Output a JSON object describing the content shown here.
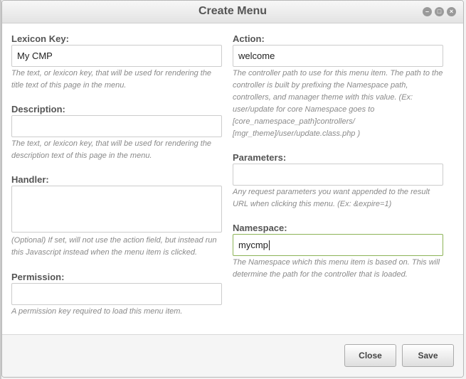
{
  "window": {
    "title": "Create Menu",
    "controls": [
      "minimize-icon",
      "maximize-icon",
      "close-icon"
    ]
  },
  "form": {
    "lexicon_key": {
      "label": "Lexicon Key:",
      "value": "My CMP",
      "hint": "The text, or lexicon key, that will be used for rendering the title text of this page in the menu."
    },
    "description": {
      "label": "Description:",
      "value": "",
      "hint": "The text, or lexicon key, that will be used for rendering the description text of this page in the menu."
    },
    "handler": {
      "label": "Handler:",
      "value": "",
      "hint": "(Optional) If set, will not use the action field, but instead run this Javascript instead when the menu item is clicked."
    },
    "permission": {
      "label": "Permission:",
      "value": "",
      "hint": "A permission key required to load this menu item."
    },
    "action": {
      "label": "Action:",
      "value": "welcome",
      "hint": "The controller path to use for this menu item. The path to the controller is built by prefixing the Namespace path, controllers, and manager theme with this value. (Ex: user/update for core Namespace goes to [core_namespace_path]controllers/ [mgr_theme]/user/update.class.php )"
    },
    "parameters": {
      "label": "Parameters:",
      "value": "",
      "hint": "Any request parameters you want appended to the result URL when clicking this menu. (Ex: &expire=1)"
    },
    "namespace": {
      "label": "Namespace:",
      "value": "mycmp",
      "hint": "The Namespace which this menu item is based on. This will determine the path for the controller that is loaded."
    }
  },
  "footer": {
    "close_label": "Close",
    "save_label": "Save"
  },
  "colors": {
    "focus_border": "#8cb357",
    "label_text": "#555555",
    "hint_text": "#8a8a8a"
  }
}
